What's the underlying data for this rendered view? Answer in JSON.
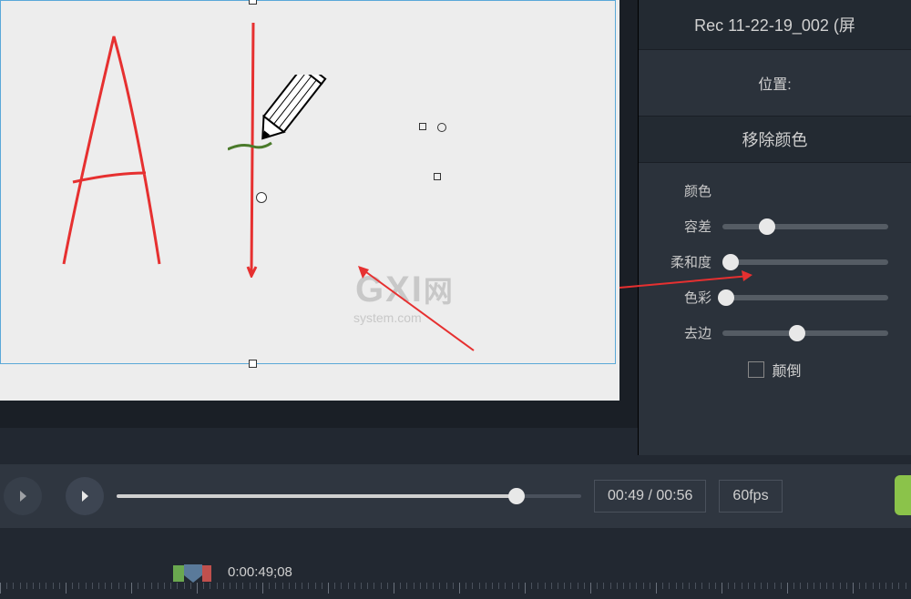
{
  "header": {
    "title": "Rec 11-22-19_002 (屏"
  },
  "position": {
    "label": "位置:"
  },
  "removeColor": {
    "title": "移除颜色",
    "colorLabel": "颜色",
    "toleranceLabel": "容差",
    "softnessLabel": "柔和度",
    "hueLabel": "色彩",
    "defringeLabel": "去边",
    "invertLabel": "颠倒",
    "tolerancePos": 27,
    "softnessPos": 5,
    "huePos": 2,
    "defringePos": 45
  },
  "playback": {
    "timeDisplay": "00:49 / 00:56",
    "fpsDisplay": "60fps"
  },
  "timeline": {
    "timecode": "0:00:49;08"
  },
  "watermark": {
    "main": "GXI",
    "net": "网",
    "sub": "system.com"
  }
}
